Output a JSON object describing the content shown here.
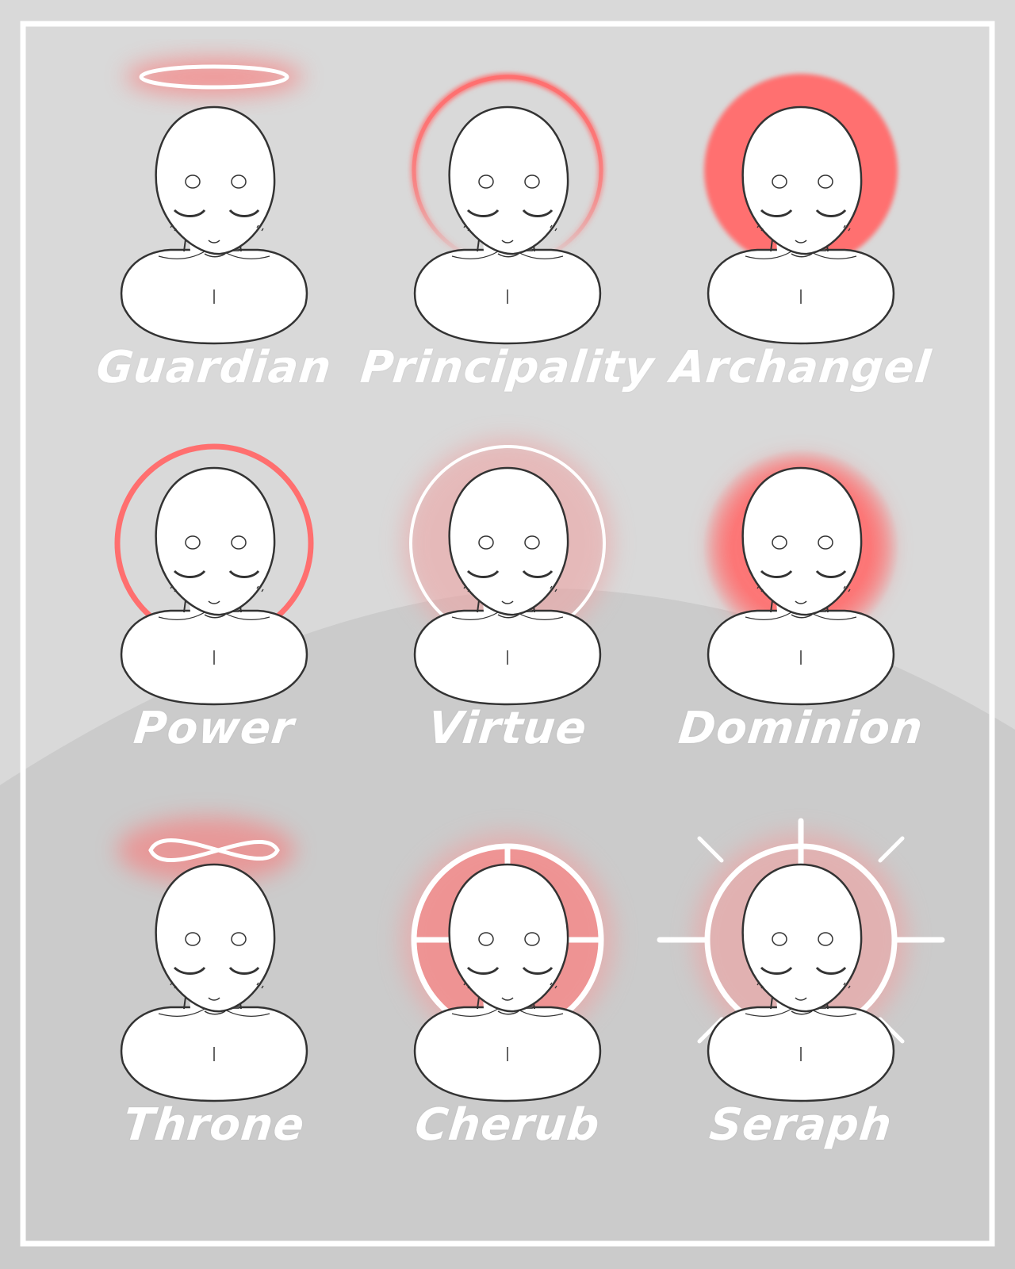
{
  "colors": {
    "background": "#d9d9d9",
    "frame": "#ffffff",
    "halo": "#ff6f6f",
    "glow": "#f0a0a0",
    "skin": "#ffffff",
    "outline": "#333333"
  },
  "halos": [
    {
      "label": "Guardian",
      "icon": "flat-ring-halo-icon"
    },
    {
      "label": "Principality",
      "icon": "fading-arc-halo-icon"
    },
    {
      "label": "Archangel",
      "icon": "solid-disc-halo-icon"
    },
    {
      "label": "Power",
      "icon": "thin-ring-halo-icon"
    },
    {
      "label": "Virtue",
      "icon": "glowing-ring-halo-icon"
    },
    {
      "label": "Dominion",
      "icon": "glowing-disc-halo-icon"
    },
    {
      "label": "Throne",
      "icon": "infinity-halo-icon"
    },
    {
      "label": "Cherub",
      "icon": "quartered-ring-halo-icon"
    },
    {
      "label": "Seraph",
      "icon": "sunburst-halo-icon"
    }
  ]
}
